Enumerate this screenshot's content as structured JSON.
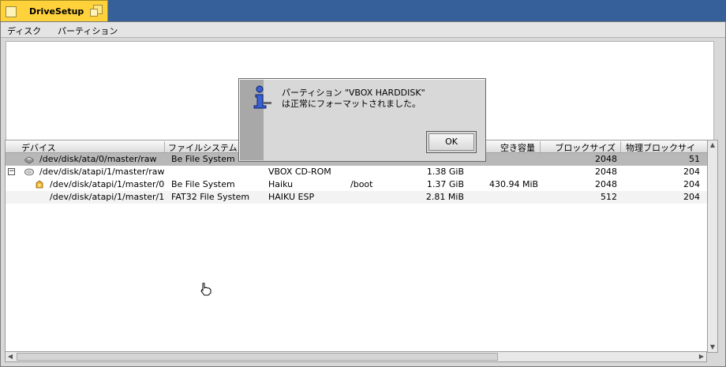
{
  "window": {
    "title": "DriveSetup"
  },
  "menu": {
    "items": [
      "ディスク",
      "パーティション"
    ]
  },
  "list": {
    "columns": [
      "デバイス",
      "ファイルシステム",
      "",
      "",
      "",
      "空き容量",
      "ブロックサイズ",
      "物理ブロックサイ"
    ],
    "rows": [
      {
        "device": "/dev/disk/ata/0/master/raw",
        "fs": "Be File System",
        "name": "",
        "mount": "",
        "size": "",
        "free": "",
        "block": "2048",
        "phys": "51",
        "icon": "harddisk-icon"
      },
      {
        "device": "/dev/disk/atapi/1/master/raw",
        "fs": "",
        "name": "VBOX CD-ROM",
        "mount": "",
        "size": "1.38 GiB",
        "free": "",
        "block": "2048",
        "phys": "204",
        "icon": "cdrom-icon"
      },
      {
        "device": "/dev/disk/atapi/1/master/0",
        "fs": "Be File System",
        "name": "Haiku",
        "mount": "/boot",
        "size": "1.37 GiB",
        "free": "430.94 MiB",
        "block": "2048",
        "phys": "204",
        "icon": "haiku-volume-icon"
      },
      {
        "device": "/dev/disk/atapi/1/master/1",
        "fs": "FAT32 File System",
        "name": "HAIKU ESP",
        "mount": "",
        "size": "2.81 MiB",
        "free": "",
        "block": "512",
        "phys": "204",
        "icon": ""
      }
    ]
  },
  "alert": {
    "line1": "パーティション \"VBOX HARDDISK\"",
    "line2": "は正常にフォーマットされました。",
    "ok_label": "OK"
  },
  "colors": {
    "desktop": "#36609a",
    "tab": "#ffd23c",
    "selection": "#b8b8b8"
  }
}
